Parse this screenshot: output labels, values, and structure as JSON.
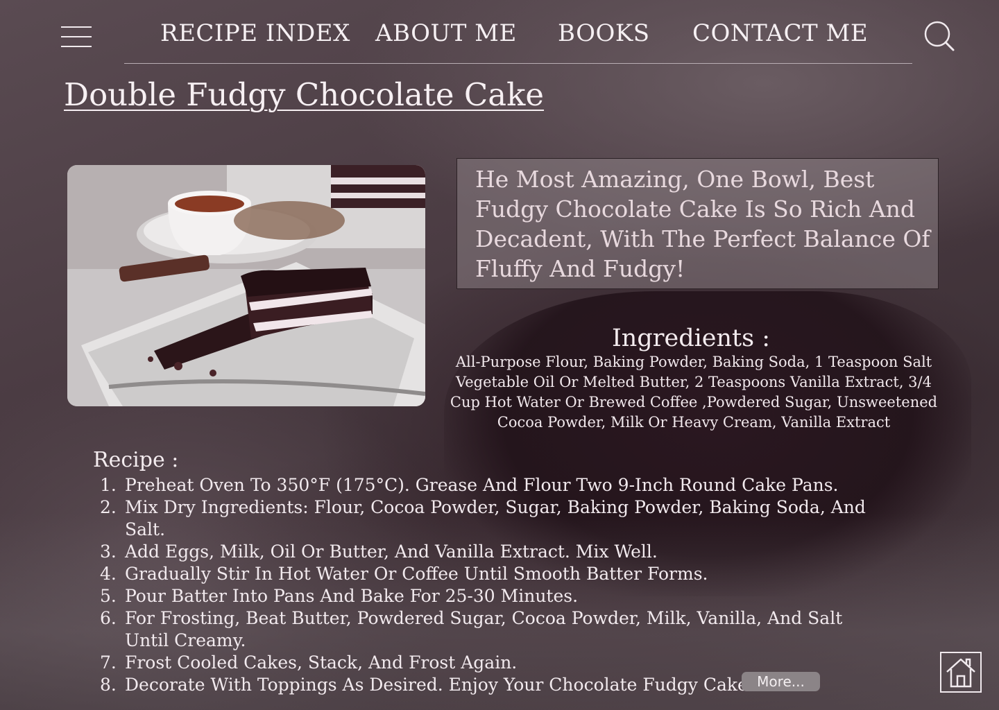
{
  "nav": {
    "links": [
      "RECIPE INDEX",
      "ABOUT ME",
      "BOOKS",
      "CONTACT ME"
    ]
  },
  "icons": {
    "menu": "hamburger-menu-icon",
    "search": "search-icon",
    "home": "home-icon"
  },
  "page": {
    "title": "Double Fudgy Chocolate Cake"
  },
  "photo": {
    "subject": "slice of layered chocolate cake with a cup of tea"
  },
  "intro": {
    "text": "He Most Amazing, One Bowl, Best Fudgy Chocolate Cake Is So Rich And Decadent, With The Perfect Balance Of Fluffy And Fudgy!"
  },
  "ingredients": {
    "heading": "Ingredients :",
    "text": "All-Purpose Flour, Baking Powder, Baking Soda, 1 Teaspoon Salt Vegetable Oil Or Melted Butter, 2 Teaspoons Vanilla Extract, 3/4 Cup Hot Water Or Brewed Coffee ,Powdered Sugar, Unsweetened Cocoa Powder,  Milk Or Heavy Cream, Vanilla Extract"
  },
  "recipe": {
    "heading": "Recipe :",
    "steps": [
      "Preheat Oven To 350°F (175°C). Grease And Flour Two 9-Inch Round Cake Pans.",
      "Mix Dry Ingredients: Flour, Cocoa Powder, Sugar, Baking Powder, Baking Soda, And Salt.",
      "Add Eggs, Milk, Oil Or Butter, And Vanilla Extract. Mix Well.",
      "Gradually Stir In Hot Water Or Coffee Until Smooth Batter Forms.",
      "Pour Batter Into Pans And Bake For 25-30 Minutes.",
      "For Frosting, Beat Butter, Powdered Sugar, Cocoa Powder, Milk, Vanilla, And Salt Until Creamy.",
      "Frost Cooled Cakes, Stack, And Frost Again.",
      "Decorate With Toppings As Desired. Enjoy Your Chocolate Fudgy Cake!"
    ],
    "more_label": "More..."
  },
  "colors": {
    "background": "#4a3b42",
    "text": "#f3ecef",
    "intro_text": "#e8d9de",
    "more_button": "#8b8487"
  }
}
